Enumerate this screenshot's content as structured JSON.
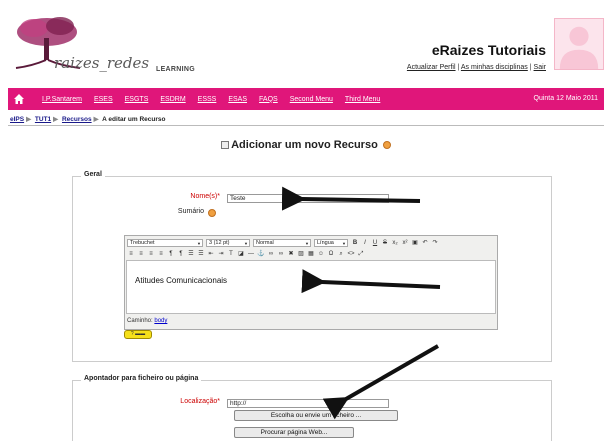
{
  "header": {
    "logo_text": "raizes_redes",
    "logo_sub": "LEARNING",
    "site_title": "eRaizes Tutoriais",
    "user_link_profile": "Actualizar Perfil",
    "user_link_courses": "As minhas disciplinas",
    "user_link_logout": "Sair",
    "separator": "|"
  },
  "nav": {
    "items": [
      "I.P.Santarem",
      "ESES",
      "ESGTS",
      "ESDRM",
      "ESSS",
      "ESAS",
      "FAQS",
      "Second Menu",
      "Third Menu"
    ],
    "date": "Quinta 12 Maio 2011",
    "home_icon": "home-icon"
  },
  "breadcrumb": {
    "items": [
      "eIPS",
      "TUT1",
      "Recursos"
    ],
    "current": "A editar um Recurso"
  },
  "page": {
    "heading": "Adicionar um novo Recurso"
  },
  "general": {
    "legend": "Geral",
    "name_label": "Nome(s)",
    "name_value": "Teste",
    "summary_label": "Sumário",
    "editor": {
      "font": "Trebuchet",
      "size": "3 (12 pt)",
      "style": "Normal",
      "lang": "Língua",
      "content": "Atitudes Comunicacionais",
      "path_label": "Caminho:",
      "path_value": "body"
    }
  },
  "link_section": {
    "legend": "Apontador para ficheiro ou página",
    "location_label": "Localização",
    "location_value": "http://",
    "choose_button": "Escolha ou envie um ficheiro ...",
    "search_button": "Procurar página Web..."
  },
  "colors": {
    "nav_bg": "#e0167a",
    "required": "#cc0000"
  }
}
